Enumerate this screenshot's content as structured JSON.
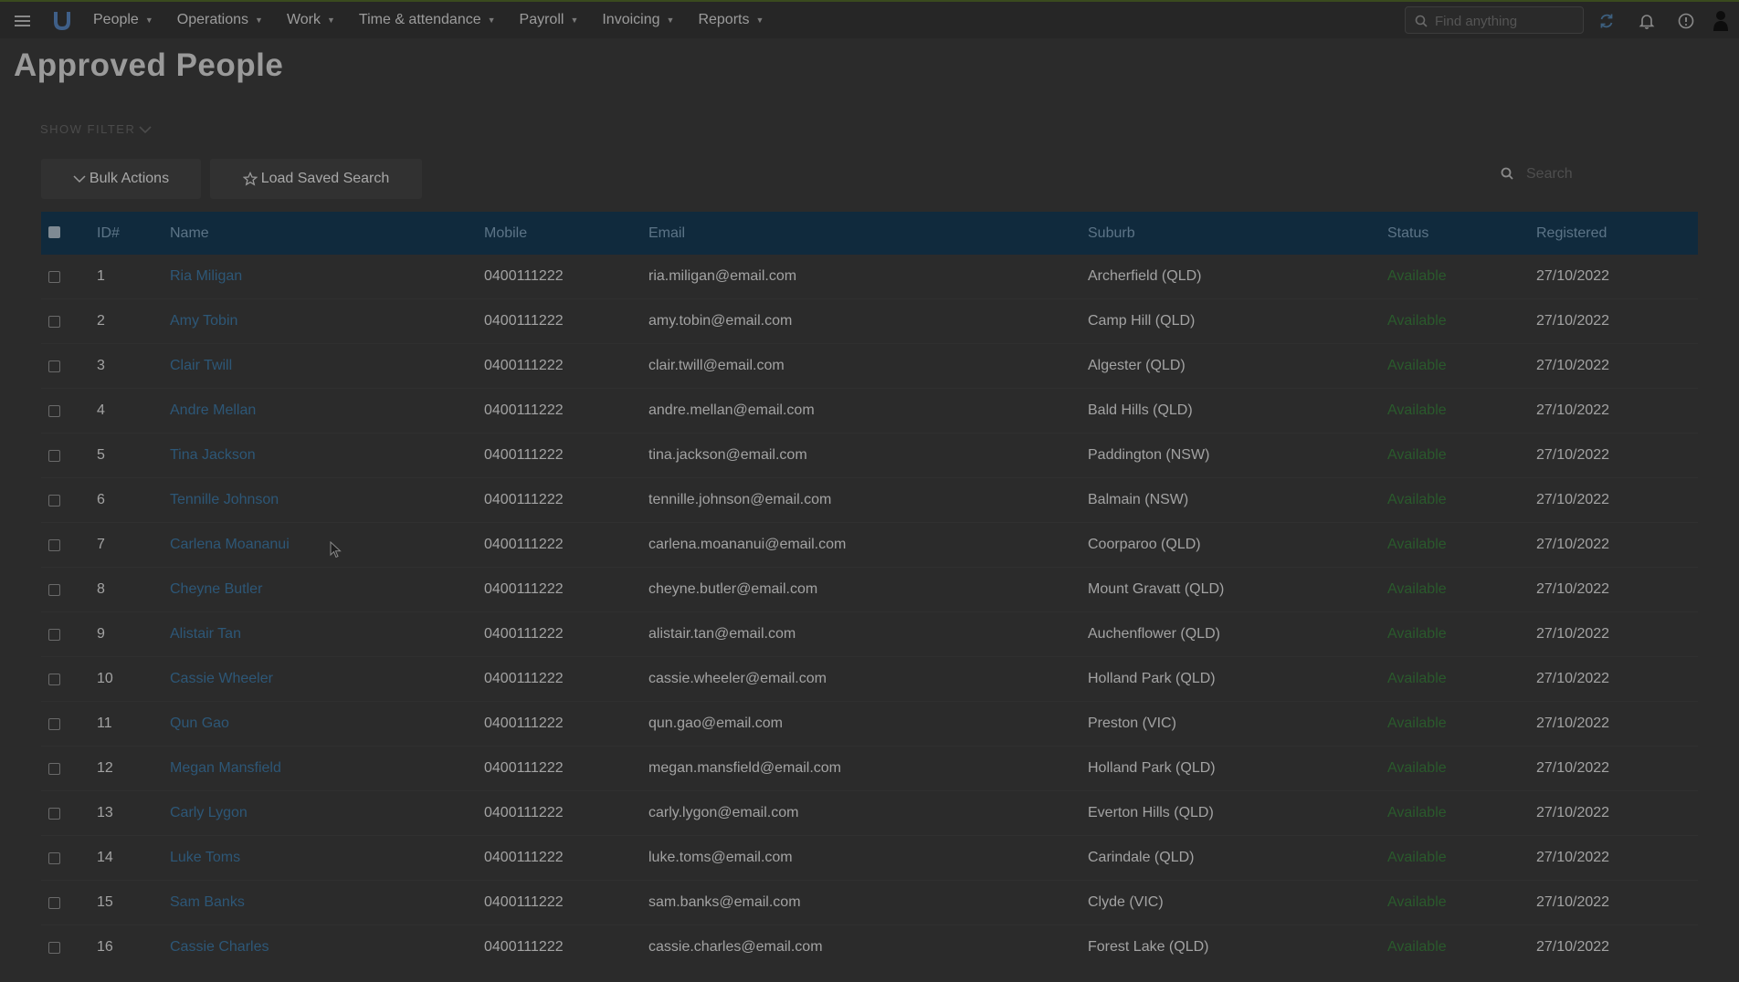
{
  "nav": {
    "items": [
      {
        "label": "People"
      },
      {
        "label": "Operations"
      },
      {
        "label": "Work"
      },
      {
        "label": "Time & attendance"
      },
      {
        "label": "Payroll"
      },
      {
        "label": "Invoicing"
      },
      {
        "label": "Reports"
      }
    ],
    "search_placeholder": "Find anything",
    "icons": [
      "menu-icon",
      "logo",
      "search-icon",
      "refresh-icon",
      "bell-icon",
      "help-icon",
      "user-icon"
    ]
  },
  "page": {
    "title": "Approved People",
    "show_filter": "SHOW FILTER",
    "bulk_actions": "Bulk Actions",
    "load_saved_search": "Load Saved Search",
    "search_placeholder": "Search"
  },
  "table": {
    "columns": [
      "ID#",
      "Name",
      "Mobile",
      "Email",
      "Suburb",
      "Status",
      "Registered"
    ],
    "rows": [
      {
        "id": "1",
        "name": "Ria Miligan",
        "mobile": "0400111222",
        "email": "ria.miligan@email.com",
        "suburb": "Archerfield (QLD)",
        "status": "Available",
        "registered": "27/10/2022"
      },
      {
        "id": "2",
        "name": "Amy Tobin",
        "mobile": "0400111222",
        "email": "amy.tobin@email.com",
        "suburb": "Camp Hill (QLD)",
        "status": "Available",
        "registered": "27/10/2022"
      },
      {
        "id": "3",
        "name": "Clair Twill",
        "mobile": "0400111222",
        "email": "clair.twill@email.com",
        "suburb": "Algester (QLD)",
        "status": "Available",
        "registered": "27/10/2022"
      },
      {
        "id": "4",
        "name": "Andre Mellan",
        "mobile": "0400111222",
        "email": "andre.mellan@email.com",
        "suburb": "Bald Hills (QLD)",
        "status": "Available",
        "registered": "27/10/2022"
      },
      {
        "id": "5",
        "name": "Tina Jackson",
        "mobile": "0400111222",
        "email": "tina.jackson@email.com",
        "suburb": "Paddington (NSW)",
        "status": "Available",
        "registered": "27/10/2022"
      },
      {
        "id": "6",
        "name": "Tennille Johnson",
        "mobile": "0400111222",
        "email": "tennille.johnson@email.com",
        "suburb": "Balmain (NSW)",
        "status": "Available",
        "registered": "27/10/2022"
      },
      {
        "id": "7",
        "name": "Carlena Moananui",
        "mobile": "0400111222",
        "email": "carlena.moananui@email.com",
        "suburb": "Coorparoo (QLD)",
        "status": "Available",
        "registered": "27/10/2022"
      },
      {
        "id": "8",
        "name": "Cheyne Butler",
        "mobile": "0400111222",
        "email": "cheyne.butler@email.com",
        "suburb": "Mount Gravatt (QLD)",
        "status": "Available",
        "registered": "27/10/2022"
      },
      {
        "id": "9",
        "name": "Alistair Tan",
        "mobile": "0400111222",
        "email": "alistair.tan@email.com",
        "suburb": "Auchenflower (QLD)",
        "status": "Available",
        "registered": "27/10/2022"
      },
      {
        "id": "10",
        "name": "Cassie Wheeler",
        "mobile": "0400111222",
        "email": "cassie.wheeler@email.com",
        "suburb": "Holland Park (QLD)",
        "status": "Available",
        "registered": "27/10/2022"
      },
      {
        "id": "11",
        "name": "Qun Gao",
        "mobile": "0400111222",
        "email": "qun.gao@email.com",
        "suburb": "Preston (VIC)",
        "status": "Available",
        "registered": "27/10/2022"
      },
      {
        "id": "12",
        "name": "Megan Mansfield",
        "mobile": "0400111222",
        "email": "megan.mansfield@email.com",
        "suburb": "Holland Park (QLD)",
        "status": "Available",
        "registered": "27/10/2022"
      },
      {
        "id": "13",
        "name": "Carly Lygon",
        "mobile": "0400111222",
        "email": "carly.lygon@email.com",
        "suburb": "Everton Hills (QLD)",
        "status": "Available",
        "registered": "27/10/2022"
      },
      {
        "id": "14",
        "name": "Luke Toms",
        "mobile": "0400111222",
        "email": "luke.toms@email.com",
        "suburb": "Carindale (QLD)",
        "status": "Available",
        "registered": "27/10/2022"
      },
      {
        "id": "15",
        "name": "Sam Banks",
        "mobile": "0400111222",
        "email": "sam.banks@email.com",
        "suburb": "Clyde (VIC)",
        "status": "Available",
        "registered": "27/10/2022"
      },
      {
        "id": "16",
        "name": "Cassie Charles",
        "mobile": "0400111222",
        "email": "cassie.charles@email.com",
        "suburb": "Forest Lake (QLD)",
        "status": "Available",
        "registered": "27/10/2022"
      }
    ]
  },
  "colors": {
    "header_bg": "#102a3d",
    "link": "#2d5777",
    "status_available": "#2a5a2c"
  }
}
